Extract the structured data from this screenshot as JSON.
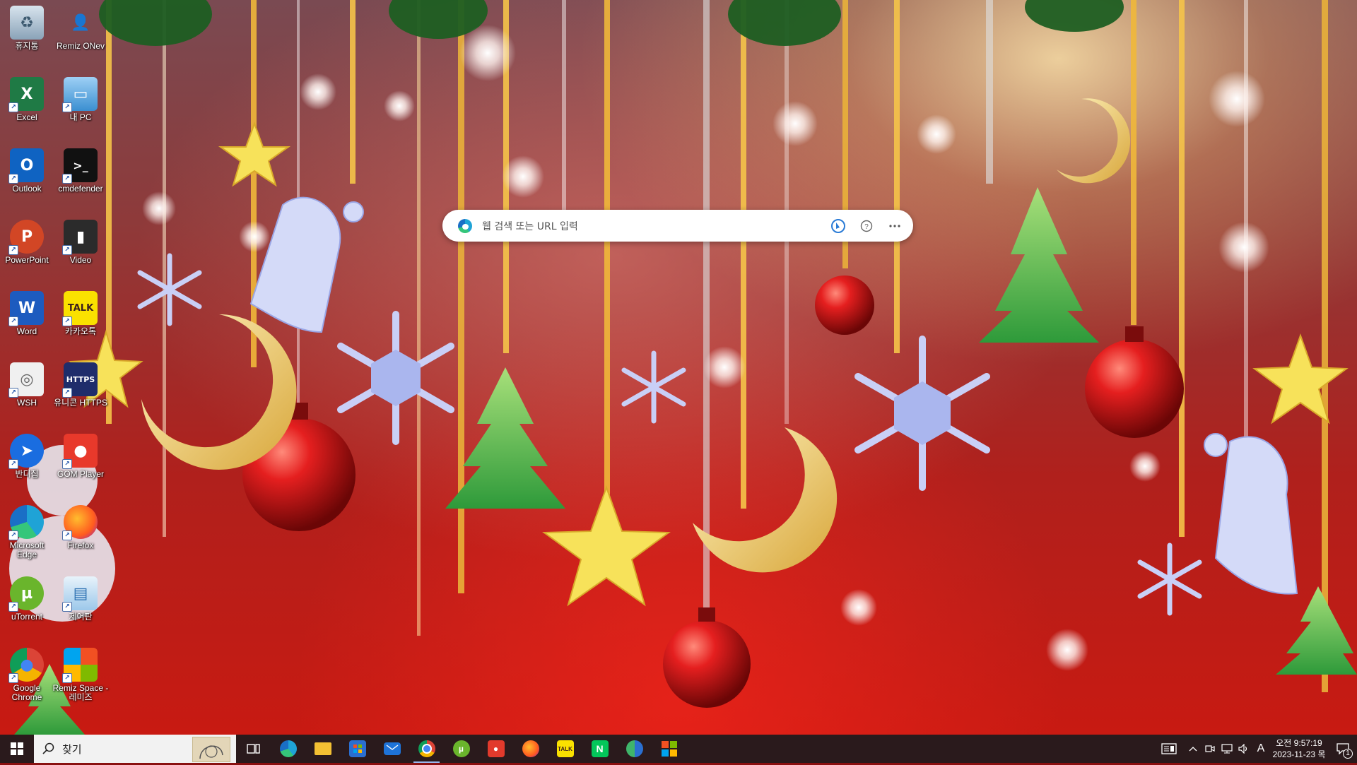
{
  "desktop": {
    "icons": [
      {
        "label": "휴지통",
        "icon": "recycle-bin-icon"
      },
      {
        "label": "Remiz ONev",
        "icon": "user-folder-icon"
      },
      {
        "label": "Excel",
        "icon": "excel-icon"
      },
      {
        "label": "내 PC",
        "icon": "this-pc-icon"
      },
      {
        "label": "Outlook",
        "icon": "outlook-icon"
      },
      {
        "label": "cmdefender",
        "icon": "cmd-icon"
      },
      {
        "label": "PowerPoint",
        "icon": "powerpoint-icon"
      },
      {
        "label": "Video",
        "icon": "video-icon"
      },
      {
        "label": "Word",
        "icon": "word-icon"
      },
      {
        "label": "카카오톡",
        "icon": "kakaotalk-icon"
      },
      {
        "label": "WSH",
        "icon": "wsh-icon"
      },
      {
        "label": "유니콘 HTTPS",
        "icon": "https-icon"
      },
      {
        "label": "반디집",
        "icon": "bandizip-icon"
      },
      {
        "label": "GOM Player",
        "icon": "gom-player-icon"
      },
      {
        "label": "Microsoft Edge",
        "icon": "edge-icon"
      },
      {
        "label": "Firefox",
        "icon": "firefox-icon"
      },
      {
        "label": "uTorrent",
        "icon": "utorrent-icon"
      },
      {
        "label": "제어판",
        "icon": "control-panel-icon"
      },
      {
        "label": "Google Chrome",
        "icon": "chrome-icon"
      },
      {
        "label": "Remiz Space - 레미즈",
        "icon": "remiz-space-icon"
      }
    ]
  },
  "search_widget": {
    "placeholder": "웹 검색 또는 URL 입력",
    "buttons": [
      "bing-chat-icon",
      "help-icon",
      "more-icon"
    ]
  },
  "taskbar": {
    "search_text": "찾기",
    "pinned": [
      {
        "name": "task-view-icon"
      },
      {
        "name": "edge-icon"
      },
      {
        "name": "file-explorer-icon"
      },
      {
        "name": "store-icon"
      },
      {
        "name": "mail-icon"
      },
      {
        "name": "chrome-icon",
        "active": true
      },
      {
        "name": "utorrent-icon"
      },
      {
        "name": "gom-player-icon"
      },
      {
        "name": "firefox-icon"
      },
      {
        "name": "kakaotalk-icon"
      },
      {
        "name": "naver-icon"
      },
      {
        "name": "edge-dev-icon"
      },
      {
        "name": "remiz-space-icon"
      }
    ],
    "tray": {
      "ime": "A",
      "time": "오전 9:57:19",
      "date": "2023-11-23 목",
      "notification_count": "1"
    }
  },
  "colors": {
    "taskbar_bg": "#2a1a1c",
    "widget_bg": "#ffffff",
    "wallpaper_red": "#c81a12"
  }
}
